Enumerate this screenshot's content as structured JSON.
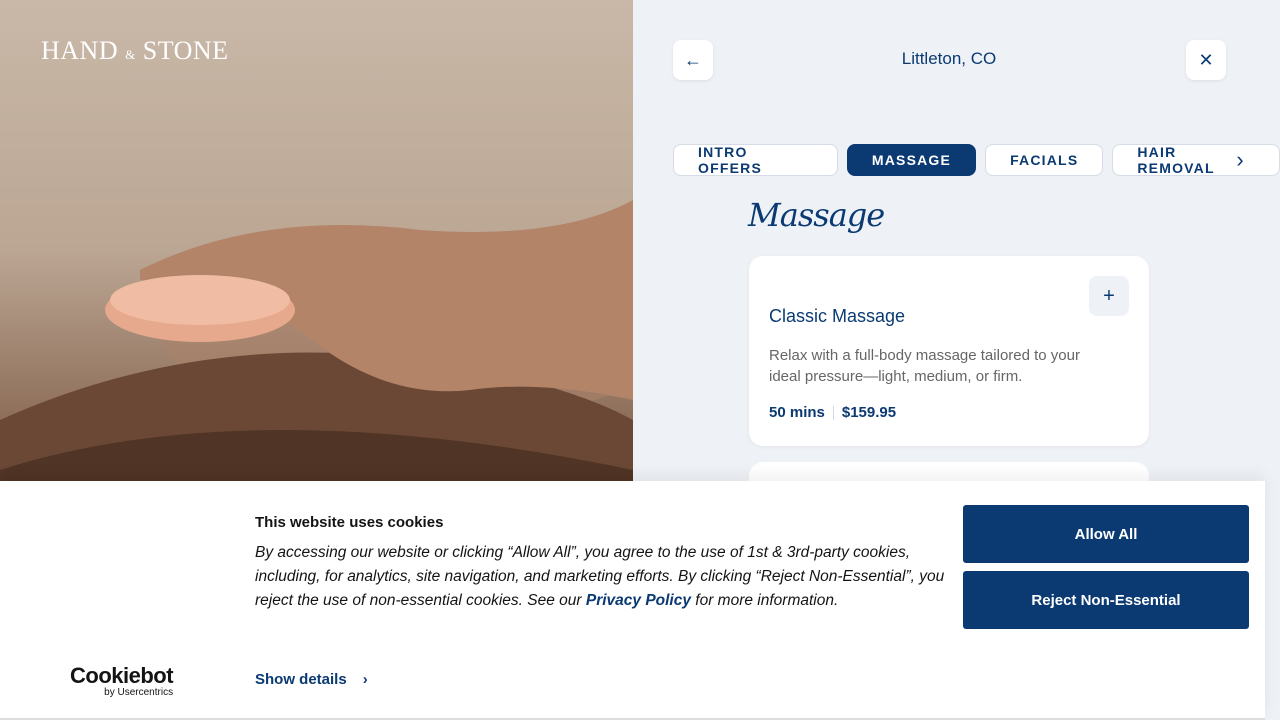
{
  "brand": {
    "logo_text_1": "HAND",
    "logo_amp": "&",
    "logo_text_2": "STONE"
  },
  "header": {
    "location": "Littleton, CO",
    "back_icon": "arrow-left-icon",
    "close_icon": "close-icon"
  },
  "tabs": [
    {
      "label": "INTRO OFFERS",
      "active": false
    },
    {
      "label": "MASSAGE",
      "active": true
    },
    {
      "label": "FACIALS",
      "active": false
    },
    {
      "label": "HAIR REMOVAL",
      "active": false
    }
  ],
  "section": {
    "title": "Massage"
  },
  "services": [
    {
      "title": "Classic Massage",
      "description": "Relax with a full-body massage tailored to your ideal pressure—light, medium, or firm.",
      "duration": "50 mins",
      "price": "$159.95"
    }
  ],
  "cookie": {
    "title": "This website uses cookies",
    "text_before": "By accessing our website or clicking “Allow All”, you agree to the use of 1st & 3rd-party cookies, including, for analytics, site navigation, and marketing efforts. By clicking “Reject Non-Essential”, you reject the use of non-essential cookies. See our ",
    "link": "Privacy Policy",
    "text_after": " for more information.",
    "show_details": "Show details",
    "allow_all": "Allow All",
    "reject": "Reject Non-Essential",
    "cookiebot_name": "Cookiebot",
    "cookiebot_by": "by Usercentrics"
  }
}
